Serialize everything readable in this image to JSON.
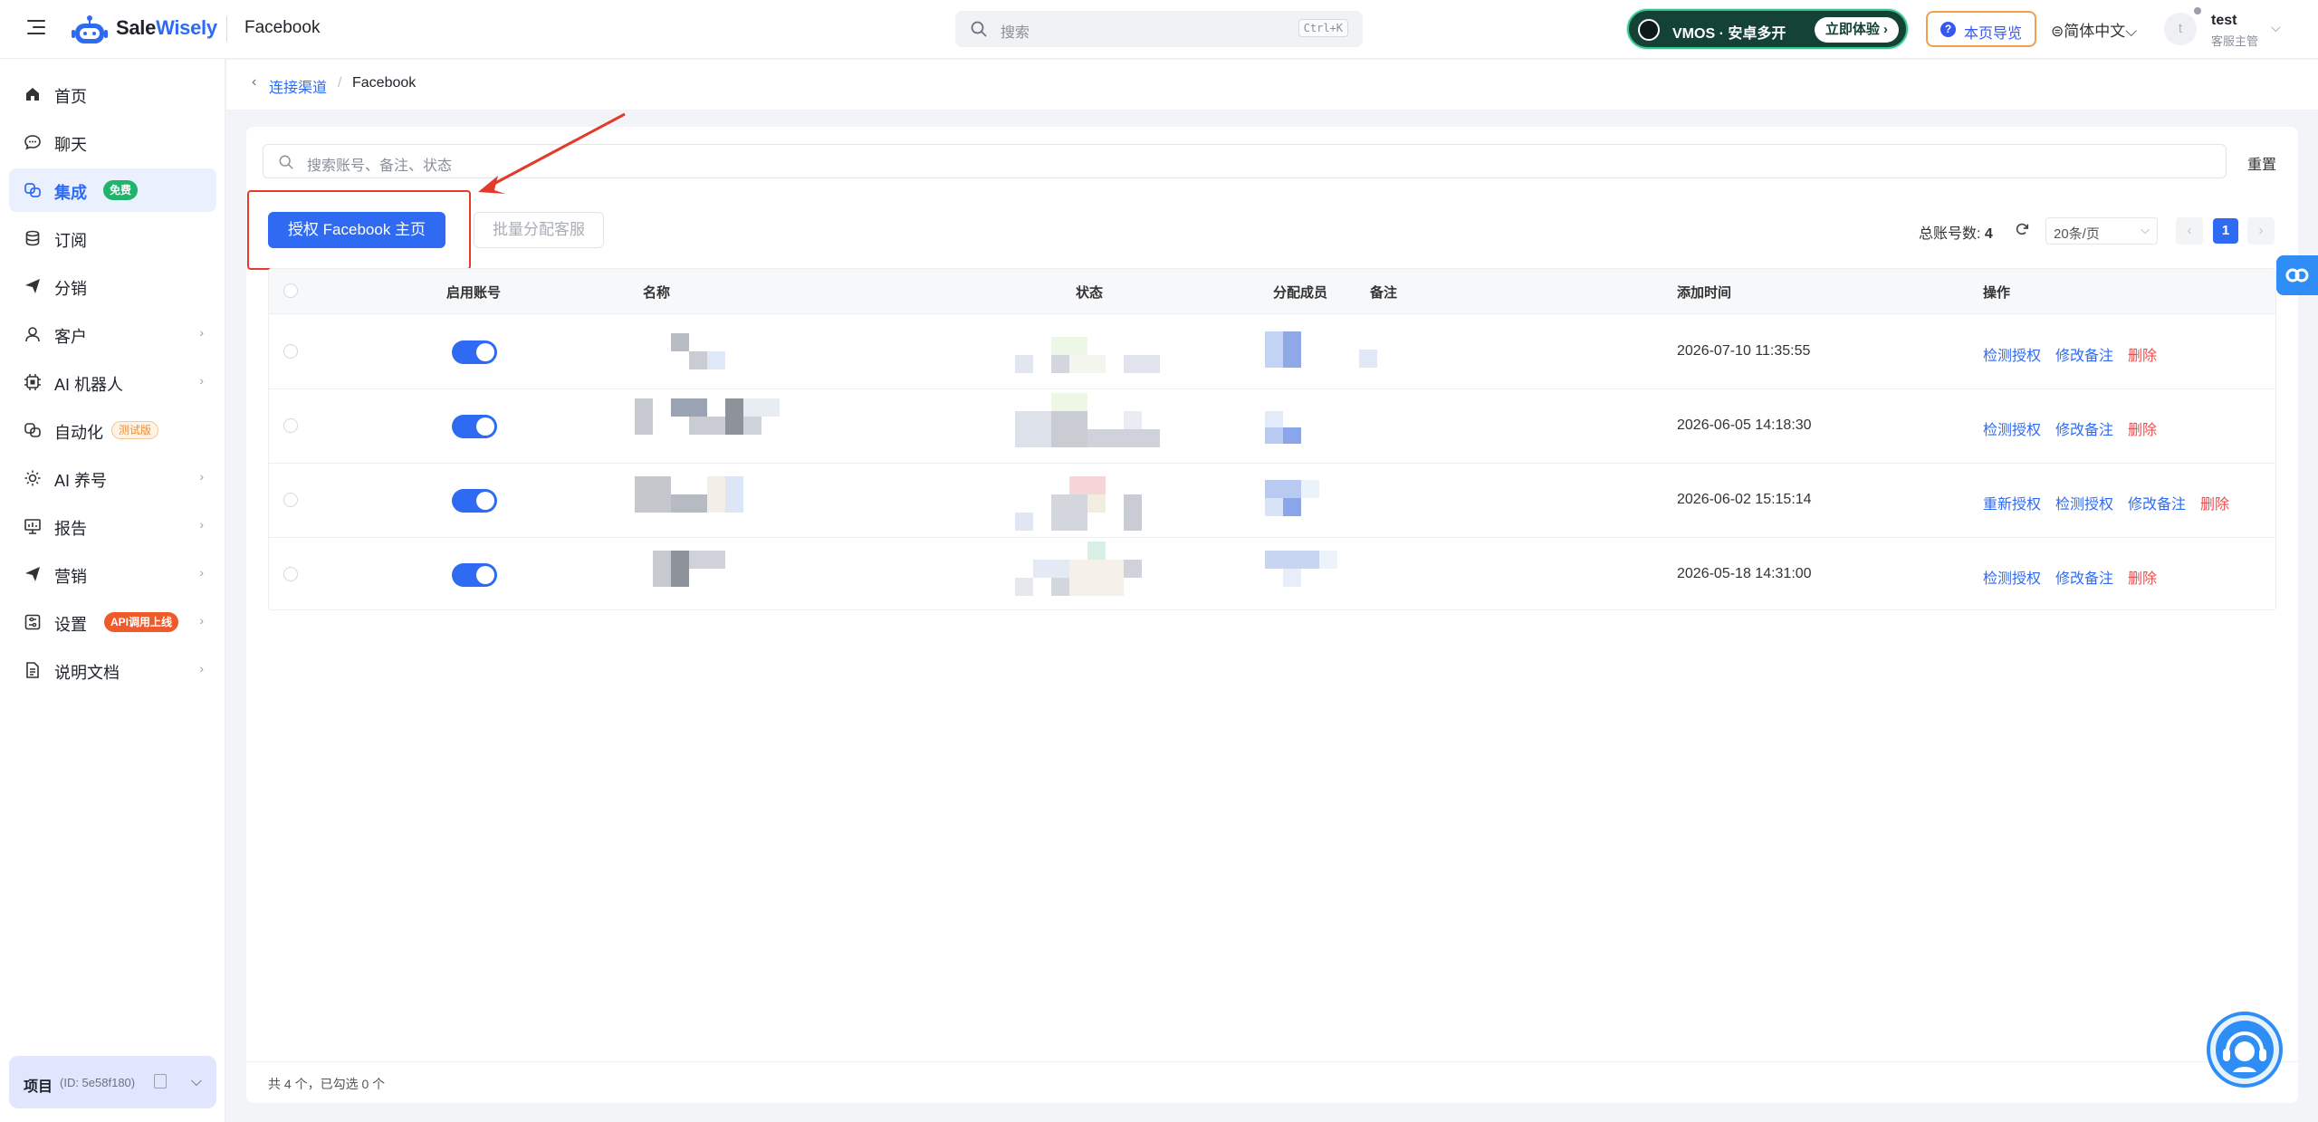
{
  "topbar": {
    "brand_main": "Sale",
    "brand_accent": "Wisely",
    "page_name": "Facebook",
    "search_placeholder": "搜索",
    "search_shortcut": "Ctrl+K",
    "promo_text": "VMOS · 安卓多开",
    "promo_button": "立即体验 ›",
    "guide_label": "本页导览",
    "language": "简体中文",
    "avatar_letter": "t",
    "user_name": "test",
    "user_role": "客服主管"
  },
  "sidebar": {
    "items": [
      {
        "label": "首页",
        "icon": "home-icon"
      },
      {
        "label": "聊天",
        "icon": "chat-icon"
      },
      {
        "label": "集成",
        "icon": "integration-icon",
        "badge": "免费",
        "active": true
      },
      {
        "label": "订阅",
        "icon": "database-icon"
      },
      {
        "label": "分销",
        "icon": "send-icon"
      },
      {
        "label": "客户",
        "icon": "user-icon",
        "chevron": true
      },
      {
        "label": "AI 机器人",
        "icon": "chip-icon",
        "chevron": true
      },
      {
        "label": "自动化",
        "icon": "automation-icon",
        "badge": "测试版"
      },
      {
        "label": "AI 养号",
        "icon": "sun-icon",
        "chevron": true
      },
      {
        "label": "报告",
        "icon": "report-icon",
        "chevron": true
      },
      {
        "label": "营销",
        "icon": "send-icon",
        "chevron": true
      },
      {
        "label": "设置",
        "icon": "settings-icon",
        "badge": "API调用上线",
        "chevron": true
      },
      {
        "label": "说明文档",
        "icon": "document-icon",
        "chevron": true
      }
    ],
    "project_label": "项目",
    "project_id": "(ID: 5e58f180)"
  },
  "breadcrumb": {
    "link": "连接渠道",
    "separator": "/",
    "current": "Facebook"
  },
  "toolbar": {
    "search_placeholder": "搜索账号、备注、状态",
    "reset": "重置",
    "authorize_button": "授权 Facebook 主页",
    "batch_assign_button": "批量分配客服",
    "total_label": "总账号数:",
    "total_value": "4",
    "page_size": "20条/页",
    "current_page": "1"
  },
  "table": {
    "headers": [
      "启用账号",
      "名称",
      "状态",
      "分配成员",
      "备注",
      "添加时间",
      "操作"
    ],
    "rows": [
      {
        "enabled": true,
        "added": "2026-07-10 11:35:55",
        "actions": [
          "检测授权",
          "修改备注",
          "删除"
        ]
      },
      {
        "enabled": true,
        "added": "2026-06-05 14:18:30",
        "actions": [
          "检测授权",
          "修改备注",
          "删除"
        ]
      },
      {
        "enabled": true,
        "added": "2026-06-02 15:15:14",
        "actions": [
          "重新授权",
          "检测授权",
          "修改备注",
          "删除"
        ]
      },
      {
        "enabled": true,
        "added": "2026-05-18 14:31:00",
        "actions": [
          "检测授权",
          "修改备注",
          "删除"
        ]
      }
    ]
  },
  "footer": {
    "summary": "共 4 个，已勾选 0 个"
  },
  "colors": {
    "primary": "#2f6bf2",
    "danger": "#ef4b4b",
    "annotation": "#e23b2a",
    "promo_green": "#144236"
  }
}
